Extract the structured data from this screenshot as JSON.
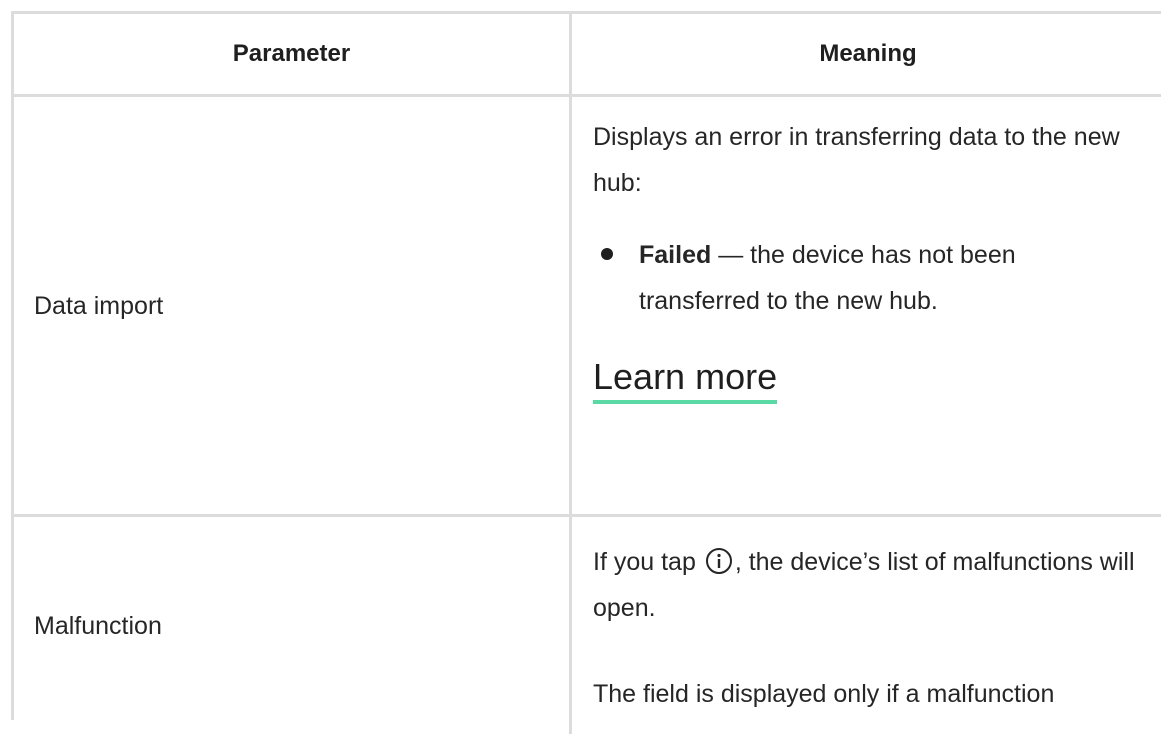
{
  "table": {
    "headers": {
      "parameter": "Parameter",
      "meaning": "Meaning"
    },
    "rows": [
      {
        "parameter": "Data import",
        "meaning_intro": "Displays an error in transferring data to the new hub:",
        "bullet": {
          "strong": "Failed",
          "rest": " — the device has not been transferred to the new hub."
        },
        "link_label": "Learn more"
      },
      {
        "parameter": "Malfunction",
        "meaning_part1": "If you tap",
        "meaning_part2": ", the device’s list of malfunctions will open.",
        "meaning_extra": "The field is displayed only if a malfunction"
      }
    ]
  },
  "icons": {
    "info": "info-circle-icon"
  },
  "colors": {
    "border": "#dcdcdc",
    "link_underline": "#5ad9a4",
    "text": "#262626"
  }
}
